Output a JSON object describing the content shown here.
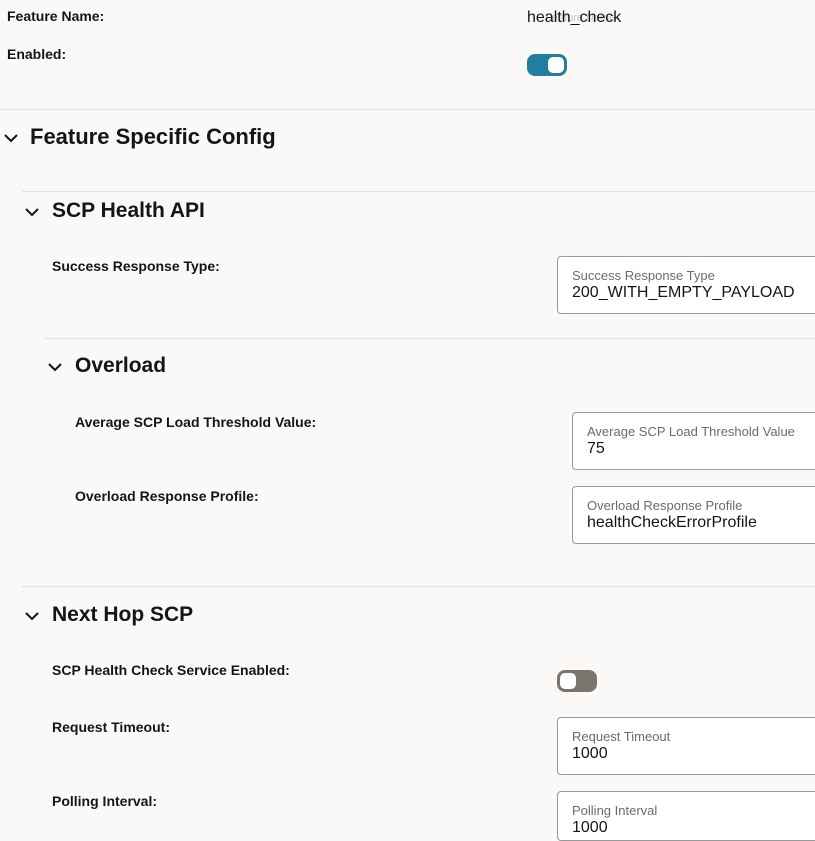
{
  "feature": {
    "name_label": "Feature Name:",
    "name_value": "health_check",
    "name_ghost": "Feature Name",
    "enabled_label": "Enabled:",
    "enabled": true
  },
  "feature_specific": {
    "title": "Feature Specific Config"
  },
  "scp_health_api": {
    "title": "SCP Health API",
    "success_response_type_label": "Success Response Type:",
    "success_response_type_field_label": "Success Response Type",
    "success_response_type_value": "200_WITH_EMPTY_PAYLOAD"
  },
  "overload": {
    "title": "Overload",
    "avg_threshold_label": "Average SCP Load Threshold Value:",
    "avg_threshold_field_label": "Average SCP Load Threshold Value",
    "avg_threshold_value": "75",
    "response_profile_label": "Overload Response Profile:",
    "response_profile_field_label": "Overload Response Profile",
    "response_profile_value": "healthCheckErrorProfile"
  },
  "next_hop_scp": {
    "title": "Next Hop SCP",
    "service_enabled_label": "SCP Health Check Service Enabled:",
    "service_enabled": false,
    "request_timeout_label": "Request Timeout:",
    "request_timeout_field_label": "Request Timeout",
    "request_timeout_value": "1000",
    "polling_interval_label": "Polling Interval:",
    "polling_interval_field_label": "Polling Interval",
    "polling_interval_value": "1000"
  },
  "colors": {
    "toggle_on": "#227e9e",
    "toggle_off": "#7a736e",
    "background": "#faf9f8"
  }
}
